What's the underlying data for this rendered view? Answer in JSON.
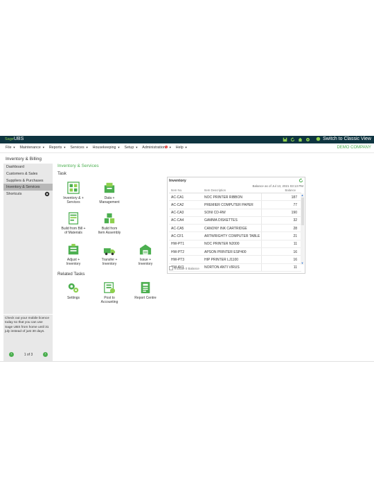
{
  "titlebar": {
    "brand_sage": "Sage",
    "brand_ubs": "UBS",
    "classic_view": "Switch to Classic View"
  },
  "menu": {
    "items": [
      "File",
      "Maintenance",
      "Reports",
      "Services",
      "Housekeeping",
      "Setup",
      "Administration",
      "Help"
    ],
    "admin_badge": "1",
    "company": "DEMO COMPANY"
  },
  "breadcrumb": "Inventory & Billing",
  "sidebar": {
    "items": [
      "Dashboard",
      "Customers & Sales",
      "Suppliers & Purchases",
      "Inventory & Services",
      "Shortcuts"
    ],
    "promo": "Check out your mobile licence today so that you can use Sage UBS from home until 31 july instead of just 30 days.",
    "pager": "1 of 3"
  },
  "main": {
    "title": "Inventory & Services",
    "task_heading": "Task",
    "tasks": [
      {
        "label1": "Inventory &",
        "label2": "Services",
        "plus": "+"
      },
      {
        "label1": "Data",
        "label2": "Management",
        "plus": "+"
      },
      {
        "label1": "Build from Bill",
        "label2": "of Materials",
        "plus": "+"
      },
      {
        "label1": "Build from",
        "label2": "Item Assembly",
        "plus": ""
      },
      {
        "label1": "Adjust",
        "label2": "Inventory",
        "plus": "+"
      },
      {
        "label1": "Transfer",
        "label2": "Inventory",
        "plus": "+"
      },
      {
        "label1": "Issue",
        "label2": "Inventory",
        "plus": "+"
      }
    ],
    "related_heading": "Related Tasks",
    "related": [
      {
        "label1": "Settings",
        "label2": ""
      },
      {
        "label1": "Post to",
        "label2": "Accounting"
      },
      {
        "label1": "Report Centre",
        "label2": ""
      }
    ]
  },
  "inventory_panel": {
    "title": "Inventory",
    "as_of": "Balance as of Jul 13, 2021 03:13 PM",
    "col_item": "Item No.",
    "col_desc": "Item Description",
    "col_bal": "Balance",
    "rows": [
      {
        "item": "AC-CA1",
        "desc": "NOC PRINTER RIBBON",
        "bal": "187"
      },
      {
        "item": "AC-CA2",
        "desc": "PREMIER COMPUTER PAPER",
        "bal": "77"
      },
      {
        "item": "AC-CA3",
        "desc": "SONI CD-RW",
        "bal": "190"
      },
      {
        "item": "AC-CA4",
        "desc": "GAMMA DISKETTES",
        "bal": "32"
      },
      {
        "item": "AC-CA5",
        "desc": "CANONY INK CARTRIDGE",
        "bal": "28"
      },
      {
        "item": "AC-CF1",
        "desc": "ARTWRIGHTY COMPUTER TABLE",
        "bal": "21"
      },
      {
        "item": "HW-PT1",
        "desc": "NOC PRINTER N2000",
        "bal": "11"
      },
      {
        "item": "HW-PT2",
        "desc": "APSON PRINTER ESP400",
        "bal": "16"
      },
      {
        "item": "HW-PT3",
        "desc": "HIP PRINTER LJ1100",
        "bal": "16"
      },
      {
        "item": "SW-AV1",
        "desc": "NORTON ANTI VIRUS",
        "bal": "11"
      }
    ],
    "include_zero": "Include 0 Balance"
  },
  "colors": {
    "accent": "#4caf50",
    "titlebar": "#0e3440",
    "sidebar": "#e8e8e8"
  }
}
